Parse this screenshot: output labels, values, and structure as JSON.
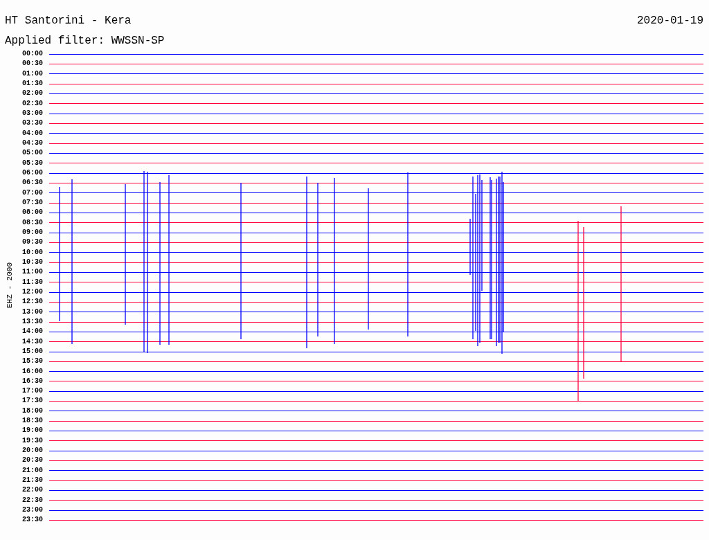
{
  "header": {
    "title": "HT Santorini - Kera",
    "date": "2020-01-19",
    "filter": "Applied filter: WWSSN-SP"
  },
  "plot": {
    "axis_label": "EHZ - 2000",
    "rows": [
      {
        "label": "00:00",
        "color": "#0000ff"
      },
      {
        "label": "00:30",
        "color": "#ff0040"
      },
      {
        "label": "01:00",
        "color": "#0000ff"
      },
      {
        "label": "01:30",
        "color": "#ff0040"
      },
      {
        "label": "02:00",
        "color": "#0000ff"
      },
      {
        "label": "02:30",
        "color": "#ff0040"
      },
      {
        "label": "03:00",
        "color": "#0000ff"
      },
      {
        "label": "03:30",
        "color": "#ff0040"
      },
      {
        "label": "04:00",
        "color": "#0000ff"
      },
      {
        "label": "04:30",
        "color": "#ff0040"
      },
      {
        "label": "05:00",
        "color": "#0000ff"
      },
      {
        "label": "05:30",
        "color": "#ff0040"
      },
      {
        "label": "06:00",
        "color": "#0000ff"
      },
      {
        "label": "06:30",
        "color": "#ff0040"
      },
      {
        "label": "07:00",
        "color": "#0000ff"
      },
      {
        "label": "07:30",
        "color": "#ff0040"
      },
      {
        "label": "08:00",
        "color": "#0000ff"
      },
      {
        "label": "08:30",
        "color": "#ff0040"
      },
      {
        "label": "09:00",
        "color": "#0000ff"
      },
      {
        "label": "09:30",
        "color": "#ff0040"
      },
      {
        "label": "10:00",
        "color": "#0000ff"
      },
      {
        "label": "10:30",
        "color": "#ff0040"
      },
      {
        "label": "11:00",
        "color": "#0000ff"
      },
      {
        "label": "11:30",
        "color": "#ff0040"
      },
      {
        "label": "12:00",
        "color": "#0000ff"
      },
      {
        "label": "12:30",
        "color": "#ff0040"
      },
      {
        "label": "13:00",
        "color": "#0000ff"
      },
      {
        "label": "13:30",
        "color": "#ff0040"
      },
      {
        "label": "14:00",
        "color": "#0000ff"
      },
      {
        "label": "14:30",
        "color": "#ff0040"
      },
      {
        "label": "15:00",
        "color": "#0000ff"
      },
      {
        "label": "15:30",
        "color": "#ff0040"
      },
      {
        "label": "16:00",
        "color": "#0000ff"
      },
      {
        "label": "16:30",
        "color": "#ff0040"
      },
      {
        "label": "17:00",
        "color": "#0000ff"
      },
      {
        "label": "17:30",
        "color": "#ff0040"
      },
      {
        "label": "18:00",
        "color": "#0000ff"
      },
      {
        "label": "18:30",
        "color": "#ff0040"
      },
      {
        "label": "19:00",
        "color": "#0000ff"
      },
      {
        "label": "19:30",
        "color": "#ff0040"
      },
      {
        "label": "20:00",
        "color": "#0000ff"
      },
      {
        "label": "20:30",
        "color": "#ff0040"
      },
      {
        "label": "21:00",
        "color": "#0000ff"
      },
      {
        "label": "21:30",
        "color": "#ff0040"
      },
      {
        "label": "22:00",
        "color": "#0000ff"
      },
      {
        "label": "22:30",
        "color": "#ff0040"
      },
      {
        "label": "23:00",
        "color": "#0000ff"
      },
      {
        "label": "23:30",
        "color": "#ff0040"
      }
    ]
  }
}
